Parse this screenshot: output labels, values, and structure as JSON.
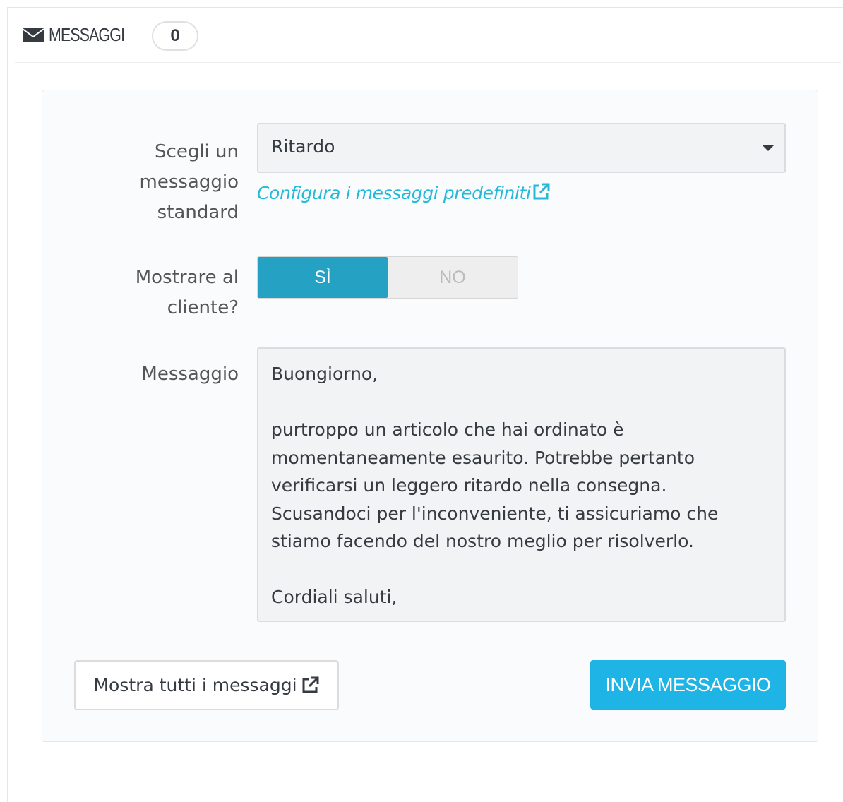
{
  "header": {
    "title": "MESSAGGI",
    "count": "0",
    "icon": "envelope-icon"
  },
  "form": {
    "standard_message_label": "Scegli un messaggio standard",
    "standard_message_value": "Ritardo",
    "config_link": "Configura i messaggi predefiniti",
    "show_client_label": "Mostrare al cliente?",
    "toggle_yes": "SÌ",
    "toggle_no": "NO",
    "toggle_selected": "SÌ",
    "message_label": "Messaggio",
    "message_text": "Buongiorno,\n\npurtroppo un articolo che hai ordinato è momentaneamente esaurito. Potrebbe pertanto verificarsi un leggero ritardo nella consegna. Scusandoci per l'inconveniente, ti assicuriamo che stiamo facendo del nostro meglio per risolverlo.\n\nCordiali saluti,"
  },
  "actions": {
    "show_all_label": "Mostra tutti i messaggi",
    "send_label": "INVIA MESSAGGIO"
  },
  "colors": {
    "accent": "#25b9d7",
    "toggle_on": "#25a1c4",
    "send_button": "#1eb5e6"
  }
}
